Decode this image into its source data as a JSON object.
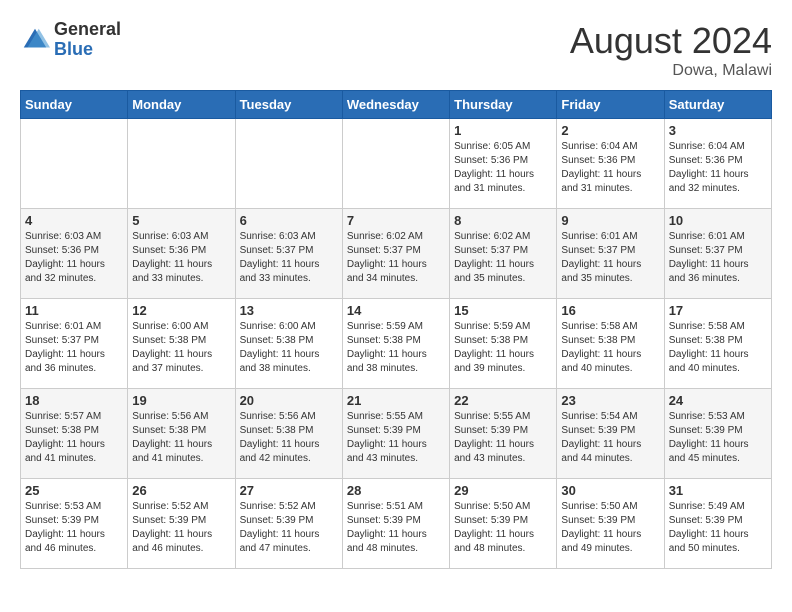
{
  "logo": {
    "general": "General",
    "blue": "Blue"
  },
  "title": {
    "month_year": "August 2024",
    "location": "Dowa, Malawi"
  },
  "days_of_week": [
    "Sunday",
    "Monday",
    "Tuesday",
    "Wednesday",
    "Thursday",
    "Friday",
    "Saturday"
  ],
  "weeks": [
    [
      {
        "day": "",
        "sunrise": "",
        "sunset": "",
        "daylight": ""
      },
      {
        "day": "",
        "sunrise": "",
        "sunset": "",
        "daylight": ""
      },
      {
        "day": "",
        "sunrise": "",
        "sunset": "",
        "daylight": ""
      },
      {
        "day": "",
        "sunrise": "",
        "sunset": "",
        "daylight": ""
      },
      {
        "day": "1",
        "sunrise": "Sunrise: 6:05 AM",
        "sunset": "Sunset: 5:36 PM",
        "daylight": "Daylight: 11 hours and 31 minutes."
      },
      {
        "day": "2",
        "sunrise": "Sunrise: 6:04 AM",
        "sunset": "Sunset: 5:36 PM",
        "daylight": "Daylight: 11 hours and 31 minutes."
      },
      {
        "day": "3",
        "sunrise": "Sunrise: 6:04 AM",
        "sunset": "Sunset: 5:36 PM",
        "daylight": "Daylight: 11 hours and 32 minutes."
      }
    ],
    [
      {
        "day": "4",
        "sunrise": "Sunrise: 6:03 AM",
        "sunset": "Sunset: 5:36 PM",
        "daylight": "Daylight: 11 hours and 32 minutes."
      },
      {
        "day": "5",
        "sunrise": "Sunrise: 6:03 AM",
        "sunset": "Sunset: 5:36 PM",
        "daylight": "Daylight: 11 hours and 33 minutes."
      },
      {
        "day": "6",
        "sunrise": "Sunrise: 6:03 AM",
        "sunset": "Sunset: 5:37 PM",
        "daylight": "Daylight: 11 hours and 33 minutes."
      },
      {
        "day": "7",
        "sunrise": "Sunrise: 6:02 AM",
        "sunset": "Sunset: 5:37 PM",
        "daylight": "Daylight: 11 hours and 34 minutes."
      },
      {
        "day": "8",
        "sunrise": "Sunrise: 6:02 AM",
        "sunset": "Sunset: 5:37 PM",
        "daylight": "Daylight: 11 hours and 35 minutes."
      },
      {
        "day": "9",
        "sunrise": "Sunrise: 6:01 AM",
        "sunset": "Sunset: 5:37 PM",
        "daylight": "Daylight: 11 hours and 35 minutes."
      },
      {
        "day": "10",
        "sunrise": "Sunrise: 6:01 AM",
        "sunset": "Sunset: 5:37 PM",
        "daylight": "Daylight: 11 hours and 36 minutes."
      }
    ],
    [
      {
        "day": "11",
        "sunrise": "Sunrise: 6:01 AM",
        "sunset": "Sunset: 5:37 PM",
        "daylight": "Daylight: 11 hours and 36 minutes."
      },
      {
        "day": "12",
        "sunrise": "Sunrise: 6:00 AM",
        "sunset": "Sunset: 5:38 PM",
        "daylight": "Daylight: 11 hours and 37 minutes."
      },
      {
        "day": "13",
        "sunrise": "Sunrise: 6:00 AM",
        "sunset": "Sunset: 5:38 PM",
        "daylight": "Daylight: 11 hours and 38 minutes."
      },
      {
        "day": "14",
        "sunrise": "Sunrise: 5:59 AM",
        "sunset": "Sunset: 5:38 PM",
        "daylight": "Daylight: 11 hours and 38 minutes."
      },
      {
        "day": "15",
        "sunrise": "Sunrise: 5:59 AM",
        "sunset": "Sunset: 5:38 PM",
        "daylight": "Daylight: 11 hours and 39 minutes."
      },
      {
        "day": "16",
        "sunrise": "Sunrise: 5:58 AM",
        "sunset": "Sunset: 5:38 PM",
        "daylight": "Daylight: 11 hours and 40 minutes."
      },
      {
        "day": "17",
        "sunrise": "Sunrise: 5:58 AM",
        "sunset": "Sunset: 5:38 PM",
        "daylight": "Daylight: 11 hours and 40 minutes."
      }
    ],
    [
      {
        "day": "18",
        "sunrise": "Sunrise: 5:57 AM",
        "sunset": "Sunset: 5:38 PM",
        "daylight": "Daylight: 11 hours and 41 minutes."
      },
      {
        "day": "19",
        "sunrise": "Sunrise: 5:56 AM",
        "sunset": "Sunset: 5:38 PM",
        "daylight": "Daylight: 11 hours and 41 minutes."
      },
      {
        "day": "20",
        "sunrise": "Sunrise: 5:56 AM",
        "sunset": "Sunset: 5:38 PM",
        "daylight": "Daylight: 11 hours and 42 minutes."
      },
      {
        "day": "21",
        "sunrise": "Sunrise: 5:55 AM",
        "sunset": "Sunset: 5:39 PM",
        "daylight": "Daylight: 11 hours and 43 minutes."
      },
      {
        "day": "22",
        "sunrise": "Sunrise: 5:55 AM",
        "sunset": "Sunset: 5:39 PM",
        "daylight": "Daylight: 11 hours and 43 minutes."
      },
      {
        "day": "23",
        "sunrise": "Sunrise: 5:54 AM",
        "sunset": "Sunset: 5:39 PM",
        "daylight": "Daylight: 11 hours and 44 minutes."
      },
      {
        "day": "24",
        "sunrise": "Sunrise: 5:53 AM",
        "sunset": "Sunset: 5:39 PM",
        "daylight": "Daylight: 11 hours and 45 minutes."
      }
    ],
    [
      {
        "day": "25",
        "sunrise": "Sunrise: 5:53 AM",
        "sunset": "Sunset: 5:39 PM",
        "daylight": "Daylight: 11 hours and 46 minutes."
      },
      {
        "day": "26",
        "sunrise": "Sunrise: 5:52 AM",
        "sunset": "Sunset: 5:39 PM",
        "daylight": "Daylight: 11 hours and 46 minutes."
      },
      {
        "day": "27",
        "sunrise": "Sunrise: 5:52 AM",
        "sunset": "Sunset: 5:39 PM",
        "daylight": "Daylight: 11 hours and 47 minutes."
      },
      {
        "day": "28",
        "sunrise": "Sunrise: 5:51 AM",
        "sunset": "Sunset: 5:39 PM",
        "daylight": "Daylight: 11 hours and 48 minutes."
      },
      {
        "day": "29",
        "sunrise": "Sunrise: 5:50 AM",
        "sunset": "Sunset: 5:39 PM",
        "daylight": "Daylight: 11 hours and 48 minutes."
      },
      {
        "day": "30",
        "sunrise": "Sunrise: 5:50 AM",
        "sunset": "Sunset: 5:39 PM",
        "daylight": "Daylight: 11 hours and 49 minutes."
      },
      {
        "day": "31",
        "sunrise": "Sunrise: 5:49 AM",
        "sunset": "Sunset: 5:39 PM",
        "daylight": "Daylight: 11 hours and 50 minutes."
      }
    ]
  ]
}
